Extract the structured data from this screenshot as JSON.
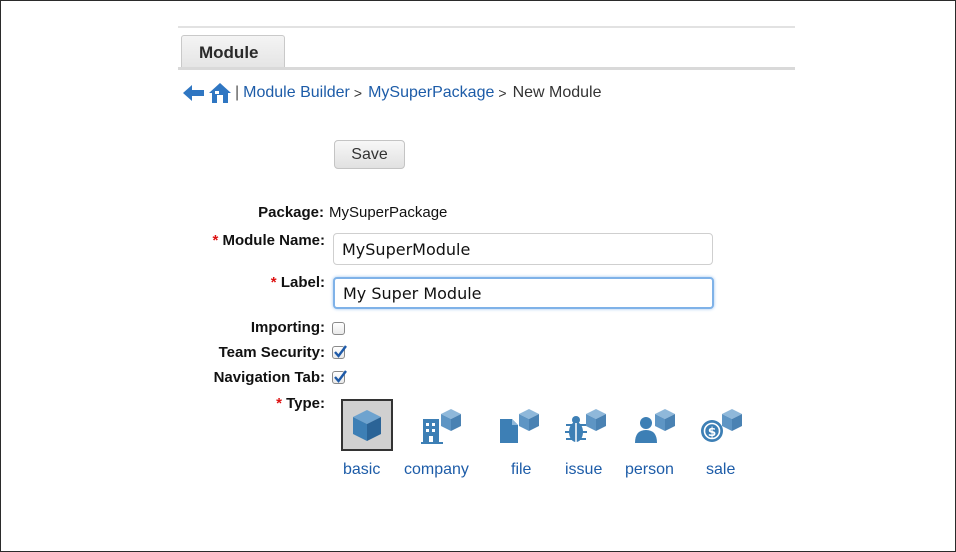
{
  "tab": {
    "label": "Module"
  },
  "breadcrumb": {
    "back_icon": "back-arrow-icon",
    "home_icon": "home-icon",
    "separator": "|",
    "links": [
      "Module Builder",
      "MySuperPackage"
    ],
    "arrow": ">",
    "current": "New Module"
  },
  "toolbar": {
    "save_label": "Save"
  },
  "form": {
    "required_mark": "*",
    "package_label": "Package:",
    "package_value": "MySuperPackage",
    "module_name_label": "Module Name:",
    "module_name_value": "MySuperModule",
    "label_label": "Label:",
    "label_value": "My Super Module",
    "importing_label": "Importing:",
    "importing_checked": false,
    "team_security_label": "Team Security:",
    "team_security_checked": true,
    "navigation_tab_label": "Navigation Tab:",
    "navigation_tab_checked": true,
    "type_label": "Type:"
  },
  "types": [
    {
      "label": "basic",
      "icon": "basic-cube-icon",
      "selected": true
    },
    {
      "label": "company",
      "icon": "company-building-icon",
      "selected": false
    },
    {
      "label": "file",
      "icon": "file-icon",
      "selected": false
    },
    {
      "label": "issue",
      "icon": "issue-bug-icon",
      "selected": false
    },
    {
      "label": "person",
      "icon": "person-icon",
      "selected": false
    },
    {
      "label": "sale",
      "icon": "sale-coin-icon",
      "selected": false
    }
  ],
  "colors": {
    "link": "#1d5ca8",
    "icon_blue": "#3d7fb5",
    "required": "#dd1111",
    "focus_border": "#7fb2e8"
  }
}
